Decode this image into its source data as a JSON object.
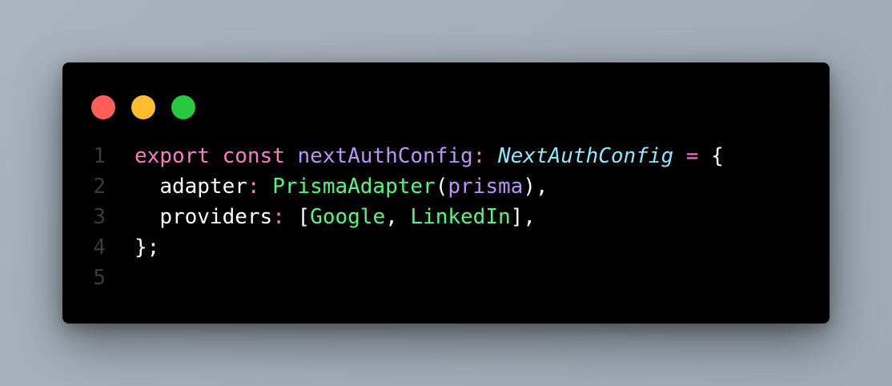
{
  "window": {
    "controls": [
      {
        "name": "close",
        "color": "#ff5f57"
      },
      {
        "name": "minimize",
        "color": "#febc2e"
      },
      {
        "name": "maximize",
        "color": "#28c840"
      }
    ]
  },
  "colors": {
    "keyword": "#ff79c6",
    "identifier": "#bd93f9",
    "type": "#8be9fd",
    "function": "#50fa7b",
    "plain": "#f8f8f2",
    "line_number": "#3b3b3b"
  },
  "code": {
    "lines": [
      {
        "number": "1",
        "tokens": [
          {
            "text": "export",
            "color": "#ff79c6"
          },
          {
            "text": " "
          },
          {
            "text": "const",
            "color": "#ff79c6"
          },
          {
            "text": " "
          },
          {
            "text": "nextAuthConfig",
            "color": "#bd93f9"
          },
          {
            "text": ":",
            "color": "#ff79c6"
          },
          {
            "text": " "
          },
          {
            "text": "NextAuthConfig",
            "color": "#8be9fd",
            "italic": true
          },
          {
            "text": " "
          },
          {
            "text": "=",
            "color": "#ff79c6"
          },
          {
            "text": " "
          },
          {
            "text": "{",
            "color": "#ffffff"
          }
        ]
      },
      {
        "number": "2",
        "tokens": [
          {
            "text": "  "
          },
          {
            "text": "adapter",
            "color": "#ffffff"
          },
          {
            "text": ":",
            "color": "#ff79c6"
          },
          {
            "text": " "
          },
          {
            "text": "PrismaAdapter",
            "color": "#50fa7b"
          },
          {
            "text": "(",
            "color": "#ffffff"
          },
          {
            "text": "prisma",
            "color": "#bd93f9"
          },
          {
            "text": "),",
            "color": "#ffffff"
          }
        ]
      },
      {
        "number": "3",
        "tokens": [
          {
            "text": "  "
          },
          {
            "text": "providers",
            "color": "#ffffff"
          },
          {
            "text": ":",
            "color": "#ff79c6"
          },
          {
            "text": " "
          },
          {
            "text": "[",
            "color": "#ffffff"
          },
          {
            "text": "Google",
            "color": "#50fa7b"
          },
          {
            "text": ", ",
            "color": "#ffffff"
          },
          {
            "text": "LinkedIn",
            "color": "#50fa7b"
          },
          {
            "text": "],",
            "color": "#ffffff"
          }
        ]
      },
      {
        "number": "4",
        "tokens": [
          {
            "text": "};",
            "color": "#ffffff"
          }
        ]
      },
      {
        "number": "5",
        "tokens": []
      }
    ]
  }
}
